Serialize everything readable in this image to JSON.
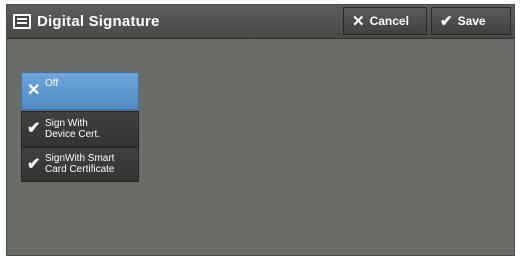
{
  "header": {
    "title": "Digital Signature",
    "title_icon": "document-icon",
    "cancel_label": "Cancel",
    "cancel_icon": "x-icon",
    "save_label": "Save",
    "save_icon": "check-icon"
  },
  "options": {
    "off": "Off",
    "device_cert_line1": "Sign With",
    "device_cert_line2": "Device Cert.",
    "smart_card_line1": "SignWith Smart",
    "smart_card_line2": "Card Certificate",
    "selected": "Off"
  },
  "colors": {
    "panel": "#6a6c68",
    "selected": "#5d96ce",
    "button": "#3a3c39"
  }
}
